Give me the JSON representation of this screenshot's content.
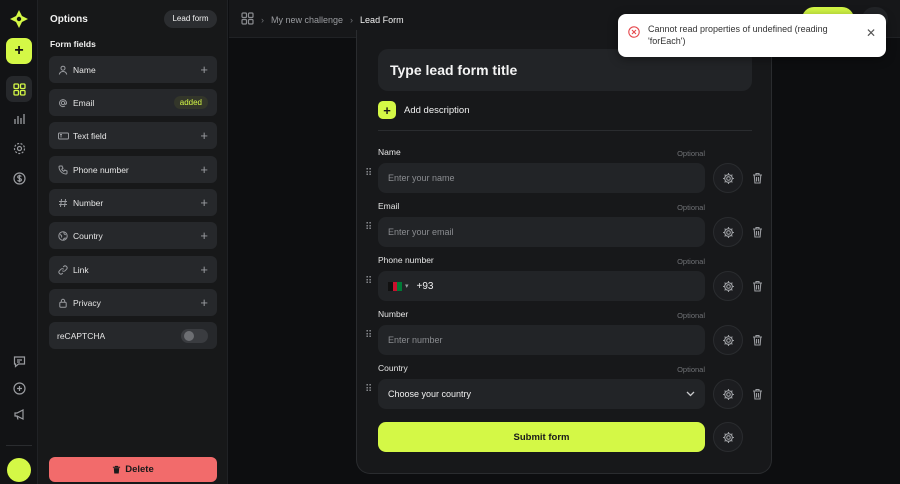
{
  "panel": {
    "title": "Options",
    "lead_form_label": "Lead form",
    "fields_label": "Form fields",
    "items": [
      {
        "label": "Name",
        "icon": "user-icon",
        "state": "add"
      },
      {
        "label": "Email",
        "icon": "at-icon",
        "state": "added",
        "badge": "added"
      },
      {
        "label": "Text field",
        "icon": "text-field-icon",
        "state": "add"
      },
      {
        "label": "Phone number",
        "icon": "phone-icon",
        "state": "add"
      },
      {
        "label": "Number",
        "icon": "hash-icon",
        "state": "add"
      },
      {
        "label": "Country",
        "icon": "globe-icon",
        "state": "add"
      },
      {
        "label": "Link",
        "icon": "link-icon",
        "state": "add"
      },
      {
        "label": "Privacy",
        "icon": "lock-icon",
        "state": "add"
      },
      {
        "label": "reCAPTCHA",
        "icon": "",
        "state": "toggle-off"
      }
    ],
    "delete_label": "Delete"
  },
  "breadcrumb": {
    "parent": "My new challenge",
    "current": "Lead Form"
  },
  "form": {
    "title_placeholder": "Type lead form title",
    "add_description": "Add description",
    "fields": [
      {
        "label": "Name",
        "optional": "Optional",
        "placeholder": "Enter your name"
      },
      {
        "label": "Email",
        "optional": "Optional",
        "placeholder": "Enter your email"
      },
      {
        "label": "Phone number",
        "optional": "Optional",
        "value": "+93"
      },
      {
        "label": "Number",
        "optional": "Optional",
        "placeholder": "Enter number"
      },
      {
        "label": "Country",
        "optional": "Optional",
        "value": "Choose your country"
      }
    ],
    "submit_label": "Submit form"
  },
  "toast": {
    "message": "Cannot read properties of undefined (reading 'forEach')"
  },
  "colors": {
    "accent": "#d4f846",
    "danger": "#f26b6b",
    "background": "#0d0e10"
  }
}
